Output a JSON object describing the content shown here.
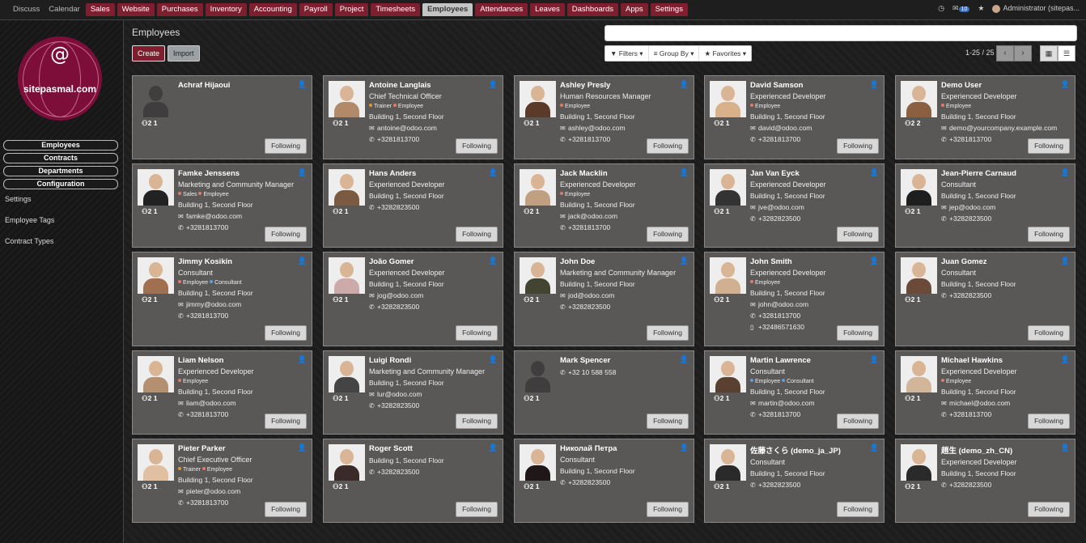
{
  "topmenu": [
    {
      "label": "Discuss",
      "style": "plain"
    },
    {
      "label": "Calendar",
      "style": "plain"
    },
    {
      "label": "Sales",
      "style": "red"
    },
    {
      "label": "Website",
      "style": "red"
    },
    {
      "label": "Purchases",
      "style": "red"
    },
    {
      "label": "Inventory",
      "style": "red"
    },
    {
      "label": "Accounting",
      "style": "red"
    },
    {
      "label": "Payroll",
      "style": "red"
    },
    {
      "label": "Project",
      "style": "red"
    },
    {
      "label": "Timesheets",
      "style": "red"
    },
    {
      "label": "Employees",
      "style": "active"
    },
    {
      "label": "Attendances",
      "style": "red"
    },
    {
      "label": "Leaves",
      "style": "red"
    },
    {
      "label": "Dashboards",
      "style": "red"
    },
    {
      "label": "Apps",
      "style": "red"
    },
    {
      "label": "Settings",
      "style": "red"
    }
  ],
  "topright": {
    "message_count": "10",
    "user": "Administrator (sitepas..."
  },
  "sidebar": {
    "logo_text": "sitepasmal.com",
    "logo_symbol": "@",
    "nav": [
      "Employees",
      "Contracts",
      "Departments",
      "Configuration"
    ],
    "links": [
      "Settings",
      "Employee Tags",
      "Contract Types"
    ]
  },
  "main": {
    "title": "Employees",
    "create_label": "Create",
    "import_label": "Import",
    "filters_label": "Filters",
    "groupby_label": "Group By",
    "favorites_label": "Favorites",
    "pager_text": "1-25 / 25",
    "prev_icon": "‹",
    "next_icon": "›",
    "following_label": "Following"
  },
  "colors": {
    "accent": "#7d1f2e",
    "card_bg": "#5a5757",
    "tag_employee": "#e07a6a",
    "tag_trainer": "#e0963a",
    "tag_consultant": "#5aa0e0",
    "tag_sales": "#e07a6a"
  },
  "employees": [
    {
      "name": "Achraf Hijaoui",
      "job": "",
      "tags": [],
      "building": "",
      "email": "",
      "phone": "",
      "mobile": "",
      "stats": "2 1",
      "photo": "blank"
    },
    {
      "name": "Antoine Langlais",
      "job": "Chief Technical Officer",
      "tags": [
        {
          "t": "Trainer",
          "c": "#e0963a"
        },
        {
          "t": "Employee",
          "c": "#e07a6a"
        }
      ],
      "building": "Building 1, Second Floor",
      "email": "antoine@odoo.com",
      "phone": "+3281813700",
      "mobile": "",
      "stats": "2 1",
      "photo": "p1"
    },
    {
      "name": "Ashley Presly",
      "job": "Human Resources Manager",
      "tags": [
        {
          "t": "Employee",
          "c": "#e07a6a"
        }
      ],
      "building": "Building 1, Second Floor",
      "email": "ashley@odoo.com",
      "phone": "+3281813700",
      "mobile": "",
      "stats": "2 1",
      "photo": "p2"
    },
    {
      "name": "David Samson",
      "job": "Experienced Developer",
      "tags": [
        {
          "t": "Employee",
          "c": "#e07a6a"
        }
      ],
      "building": "Building 1, Second Floor",
      "email": "david@odoo.com",
      "phone": "+3281813700",
      "mobile": "",
      "stats": "2 1",
      "photo": "p3"
    },
    {
      "name": "Demo User",
      "job": "Experienced Developer",
      "tags": [
        {
          "t": "Employee",
          "c": "#e07a6a"
        }
      ],
      "building": "Building 1, Second Floor",
      "email": "demo@yourcompany.example.com",
      "phone": "+3281813700",
      "mobile": "",
      "stats": "2 2",
      "photo": "p4"
    },
    {
      "name": "Famke Jenssens",
      "job": "Marketing and Community Manager",
      "tags": [
        {
          "t": "Sales",
          "c": "#e07a6a"
        },
        {
          "t": "Employee",
          "c": "#e07a6a"
        }
      ],
      "building": "Building 1, Second Floor",
      "email": "famke@odoo.com",
      "phone": "+3281813700",
      "mobile": "",
      "stats": "2 1",
      "photo": "p5"
    },
    {
      "name": "Hans Anders",
      "job": "Experienced Developer",
      "tags": [],
      "building": "Building 1, Second Floor",
      "email": "",
      "phone": "+3282823500",
      "mobile": "",
      "stats": "2 1",
      "photo": "p6"
    },
    {
      "name": "Jack Macklin",
      "job": "Experienced Developer",
      "tags": [
        {
          "t": "Employee",
          "c": "#e07a6a"
        }
      ],
      "building": "Building 1, Second Floor",
      "email": "jack@odoo.com",
      "phone": "+3281813700",
      "mobile": "",
      "stats": "2 1",
      "photo": "p7"
    },
    {
      "name": "Jan Van Eyck",
      "job": "Experienced Developer",
      "tags": [],
      "building": "Building 1, Second Floor",
      "email": "jve@odoo.com",
      "phone": "+3282823500",
      "mobile": "",
      "stats": "2 1",
      "photo": "p8"
    },
    {
      "name": "Jean-Pierre Carnaud",
      "job": "Consultant",
      "tags": [],
      "building": "Building 1, Second Floor",
      "email": "jep@odoo.com",
      "phone": "+3282823500",
      "mobile": "",
      "stats": "2 1",
      "photo": "p9"
    },
    {
      "name": "Jimmy Kosikin",
      "job": "Consultant",
      "tags": [
        {
          "t": "Employee",
          "c": "#e07a6a"
        },
        {
          "t": "Consultant",
          "c": "#5aa0e0"
        }
      ],
      "building": "Building 1, Second Floor",
      "email": "jimmy@odoo.com",
      "phone": "+3281813700",
      "mobile": "",
      "stats": "2 1",
      "photo": "p10"
    },
    {
      "name": "João Gomer",
      "job": "Experienced Developer",
      "tags": [],
      "building": "Building 1, Second Floor",
      "email": "jog@odoo.com",
      "phone": "+3282823500",
      "mobile": "",
      "stats": "2 1",
      "photo": "p11"
    },
    {
      "name": "John Doe",
      "job": "Marketing and Community Manager",
      "tags": [],
      "building": "Building 1, Second Floor",
      "email": "jod@odoo.com",
      "phone": "+3282823500",
      "mobile": "",
      "stats": "2 1",
      "photo": "p12"
    },
    {
      "name": "John Smith",
      "job": "Experienced Developer",
      "tags": [
        {
          "t": "Employee",
          "c": "#e07a6a"
        }
      ],
      "building": "Building 1, Second Floor",
      "email": "john@odoo.com",
      "phone": "+3281813700",
      "mobile": "+32486571630",
      "stats": "2 1",
      "photo": "p13"
    },
    {
      "name": "Juan Gomez",
      "job": "Consultant",
      "tags": [],
      "building": "Building 1, Second Floor",
      "email": "",
      "phone": "+3282823500",
      "mobile": "",
      "stats": "2 1",
      "photo": "p14"
    },
    {
      "name": "Liam Nelson",
      "job": "Experienced Developer",
      "tags": [
        {
          "t": "Employee",
          "c": "#e07a6a"
        }
      ],
      "building": "Building 1, Second Floor",
      "email": "liam@odoo.com",
      "phone": "+3281813700",
      "mobile": "",
      "stats": "2 1",
      "photo": "p15"
    },
    {
      "name": "Luigi Rondi",
      "job": "Marketing and Community Manager",
      "tags": [],
      "building": "Building 1, Second Floor",
      "email": "lur@odoo.com",
      "phone": "+3282823500",
      "mobile": "",
      "stats": "2 1",
      "photo": "p16"
    },
    {
      "name": "Mark Spencer",
      "job": "",
      "tags": [],
      "building": "",
      "email": "",
      "phone": "+32 10 588 558",
      "mobile": "",
      "stats": "2 1",
      "photo": "blank"
    },
    {
      "name": "Martin Lawrence",
      "job": "Consultant",
      "tags": [
        {
          "t": "Employee",
          "c": "#5aa0e0"
        },
        {
          "t": "Consultant",
          "c": "#5aa0e0"
        }
      ],
      "building": "Building 1, Second Floor",
      "email": "martin@odoo.com",
      "phone": "+3281813700",
      "mobile": "",
      "stats": "2 1",
      "photo": "p18"
    },
    {
      "name": "Michael Hawkins",
      "job": "Experienced Developer",
      "tags": [
        {
          "t": "Employee",
          "c": "#e07a6a"
        }
      ],
      "building": "Building 1, Second Floor",
      "email": "michael@odoo.com",
      "phone": "+3281813700",
      "mobile": "",
      "stats": "2 1",
      "photo": "p19"
    },
    {
      "name": "Pieter Parker",
      "job": "Chief Executive Officer",
      "tags": [
        {
          "t": "Trainer",
          "c": "#e0963a"
        },
        {
          "t": "Employee",
          "c": "#e07a6a"
        }
      ],
      "building": "Building 1, Second Floor",
      "email": "pieter@odoo.com",
      "phone": "+3281813700",
      "mobile": "",
      "stats": "2 1",
      "photo": "p20"
    },
    {
      "name": "Roger Scott",
      "job": "",
      "tags": [],
      "building": "Building 1, Second Floor",
      "email": "",
      "phone": "+3282823500",
      "mobile": "",
      "stats": "2 1",
      "photo": "p21"
    },
    {
      "name": "Николай Петра",
      "job": "Consultant",
      "tags": [],
      "building": "Building 1, Second Floor",
      "email": "",
      "phone": "+3282823500",
      "mobile": "",
      "stats": "2 1",
      "photo": "p22"
    },
    {
      "name": "佐藤さくら (demo_ja_JP)",
      "job": "Consultant",
      "tags": [],
      "building": "Building 1, Second Floor",
      "email": "",
      "phone": "+3282823500",
      "mobile": "",
      "stats": "2 1",
      "photo": "p23"
    },
    {
      "name": "趙生 (demo_zh_CN)",
      "job": "Experienced Developer",
      "tags": [],
      "building": "Building 1, Second Floor",
      "email": "",
      "phone": "+3282823500",
      "mobile": "",
      "stats": "2 1",
      "photo": "p24"
    }
  ]
}
